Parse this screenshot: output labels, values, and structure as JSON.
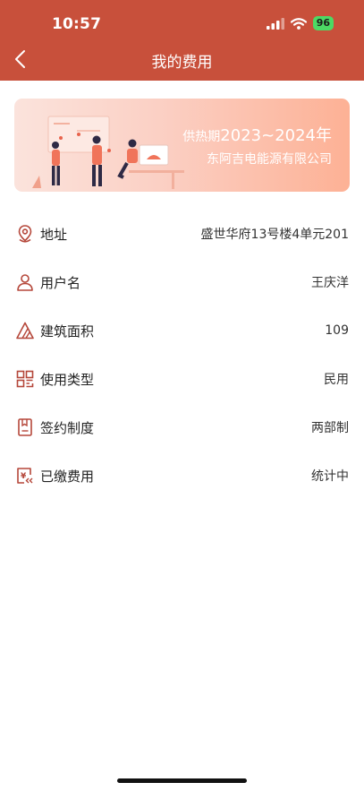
{
  "status_bar": {
    "time": "10:57",
    "battery": "96",
    "icons": [
      "signal-icon",
      "wifi-icon",
      "battery-icon"
    ]
  },
  "nav": {
    "title": "我的费用",
    "back_icon": "back-chevron-icon",
    "color": "#c8503b"
  },
  "banner": {
    "prefix": "供热期",
    "period": "2023~2024年",
    "company": "东阿吉电能源有限公司"
  },
  "rows": [
    {
      "icon": "location-pin-icon",
      "label": "地址",
      "value": "盛世华府13号楼4单元201"
    },
    {
      "icon": "user-icon",
      "label": "用户名",
      "value": "王庆洋"
    },
    {
      "icon": "area-triangle-icon",
      "label": "建筑面积",
      "value": "109"
    },
    {
      "icon": "grid-category-icon",
      "label": "使用类型",
      "value": "民用"
    },
    {
      "icon": "contract-document-icon",
      "label": "签约制度",
      "value": "两部制"
    },
    {
      "icon": "payment-receipt-icon",
      "label": "已缴费用",
      "value": "统计中"
    }
  ],
  "colors": {
    "accent": "#c8503b",
    "icon": "#b5473a",
    "battery": "#4cd964"
  }
}
